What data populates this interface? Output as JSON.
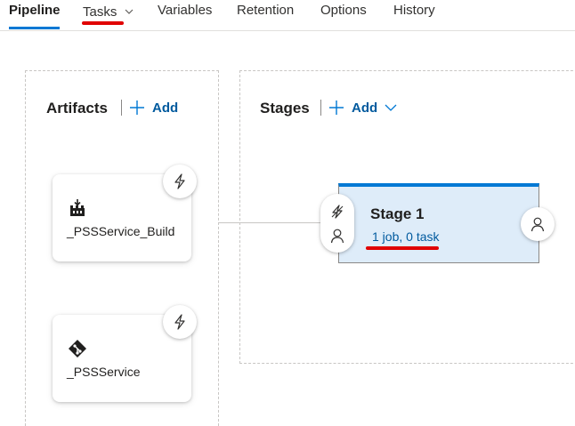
{
  "tabs": [
    {
      "id": "pipeline",
      "label": "Pipeline",
      "active": true
    },
    {
      "id": "tasks",
      "label": "Tasks",
      "has_dropdown": true
    },
    {
      "id": "variables",
      "label": "Variables"
    },
    {
      "id": "retention",
      "label": "Retention"
    },
    {
      "id": "options",
      "label": "Options"
    },
    {
      "id": "history",
      "label": "History"
    }
  ],
  "artifacts": {
    "title": "Artifacts",
    "add_label": "Add",
    "items": [
      {
        "name": "_PSSService_Build",
        "icon": "build-artifact-icon"
      },
      {
        "name": "_PSSService",
        "icon": "git-repo-icon"
      }
    ]
  },
  "stages": {
    "title": "Stages",
    "add_label": "Add",
    "items": [
      {
        "name": "Stage 1",
        "summary": "1 job, 0 task"
      }
    ]
  },
  "colors": {
    "accent": "#0078d4",
    "link": "#005a9e",
    "stage_bg": "#deecf9",
    "annotation_red": "#e00000"
  }
}
